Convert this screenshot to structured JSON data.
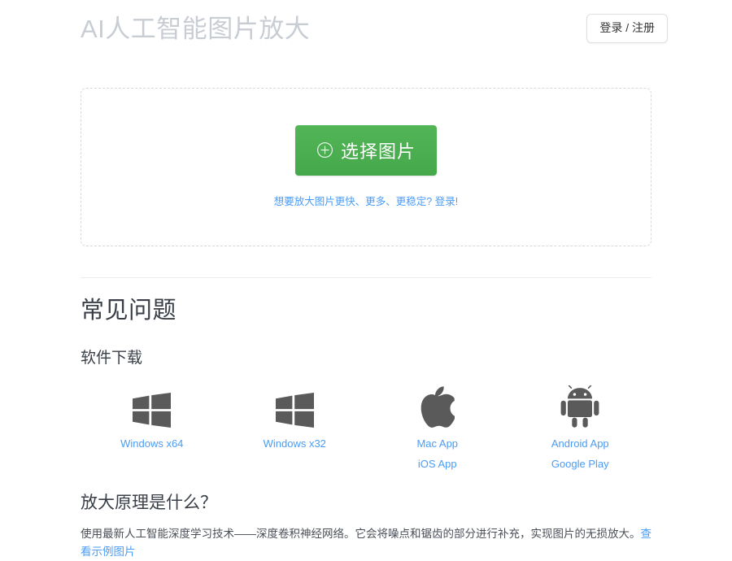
{
  "header": {
    "title": "AI人工智能图片放大",
    "login_label": "登录 / 注册"
  },
  "upload": {
    "button_label": "选择图片",
    "plus_icon": "plus-circle-icon",
    "hint_text": "想要放大图片更快、更多、更稳定? 登录!"
  },
  "faq": {
    "heading": "常见问题",
    "downloads_heading": "软件下载",
    "downloads": [
      {
        "icon": "windows-icon",
        "links": [
          "Windows x64"
        ]
      },
      {
        "icon": "windows-icon",
        "links": [
          "Windows x32"
        ]
      },
      {
        "icon": "apple-icon",
        "links": [
          "Mac App",
          "iOS App"
        ]
      },
      {
        "icon": "android-icon",
        "links": [
          "Android App",
          "Google Play"
        ]
      }
    ],
    "principle": {
      "heading": "放大原理是什么？",
      "body": "使用最新人工智能深度学习技术——深度卷积神经网络。它会将噪点和锯齿的部分进行补充，实现图片的无损放大。",
      "link_label": "查看示例图片"
    }
  },
  "colors": {
    "accent_green": "#4caf50",
    "link_blue": "#4a9cf6",
    "title_gray": "#c8cdd4",
    "icon_gray": "#5a5a5a",
    "border_gray": "#d8d8d8"
  }
}
